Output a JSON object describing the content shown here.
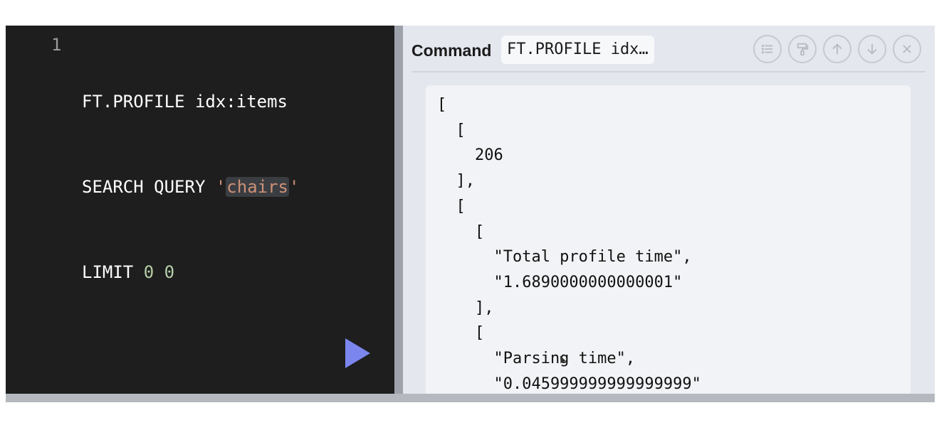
{
  "editor": {
    "line_number": "1",
    "lines": {
      "l1": "FT.PROFILE idx:items",
      "l2_prefix": "SEARCH QUERY ",
      "l2_quote_open": "'",
      "l2_string": "chairs",
      "l2_quote_close": "'",
      "l3_prefix": "LIMIT ",
      "l3_num1": "0",
      "l3_num2": "0"
    },
    "run_button_icon": "play-icon"
  },
  "result": {
    "command_label": "Command",
    "command_value": "FT.PROFILE idx…",
    "toolbar_icons": [
      "list-icon",
      "format-paint-icon",
      "arrow-up-icon",
      "arrow-down-icon",
      "close-icon"
    ],
    "output_text": "[\n  [\n    206\n  ],\n  [\n    [\n      \"Total profile time\",\n      \"1.6890000000000001\"\n    ],\n    [\n      \"Parsing time\",\n      \"0.045999999999999999\""
  },
  "colors": {
    "editor_bg": "#1e1e1e",
    "string": "#ce9178",
    "number": "#b5cea8",
    "run_button": "#7b86ee",
    "result_bg": "#e4e7ee"
  }
}
